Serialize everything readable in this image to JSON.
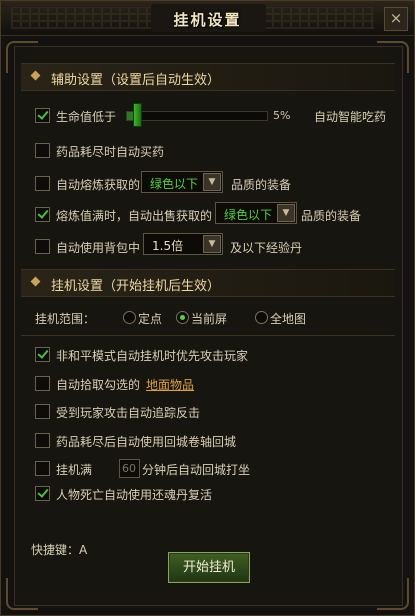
{
  "window": {
    "title": "挂机设置",
    "close_symbol": "×"
  },
  "assist": {
    "header": "辅助设置（设置后自动生效）",
    "hp_label": "生命值低于",
    "hp_value": "5%",
    "hp_fraction": 0.05,
    "auto_drink": "自动智能吃药",
    "items": [
      {
        "label": "药品耗尽时自动买药",
        "checked": false
      },
      {
        "label_pre": "自动熔炼获取的",
        "select": "绿色以下",
        "label_post": "品质的装备",
        "checked": false
      },
      {
        "label_pre": "熔炼值满时，自动出售获取的",
        "select": "绿色以下",
        "label_post": "品质的装备",
        "checked": true
      },
      {
        "label_pre": "自动使用背包中",
        "select": "1.5倍",
        "label_post": "及以下经验丹",
        "checked": false
      }
    ]
  },
  "afk": {
    "header": "挂机设置（开始挂机后生效）",
    "range_label": "挂机范围：",
    "range_options": [
      "定点",
      "当前屏",
      "全地图"
    ],
    "range_selected": 1,
    "items": [
      {
        "label": "非和平模式自动挂机时优先攻击玩家",
        "checked": true
      },
      {
        "label": "自动拾取勾选的",
        "link": "地面物品",
        "checked": false
      },
      {
        "label": "受到玩家攻击自动追踪反击",
        "checked": false
      },
      {
        "label": "药品耗尽后自动使用回城卷轴回城",
        "checked": false
      },
      {
        "label_pre": "挂机满",
        "input": "60",
        "label_post": "分钟后自动回城打坐",
        "checked": false
      },
      {
        "label": "人物死亡自动使用还魂丹复活",
        "checked": true
      }
    ]
  },
  "footer": {
    "hotkey": "快捷键：A",
    "start_button": "开始挂机"
  }
}
